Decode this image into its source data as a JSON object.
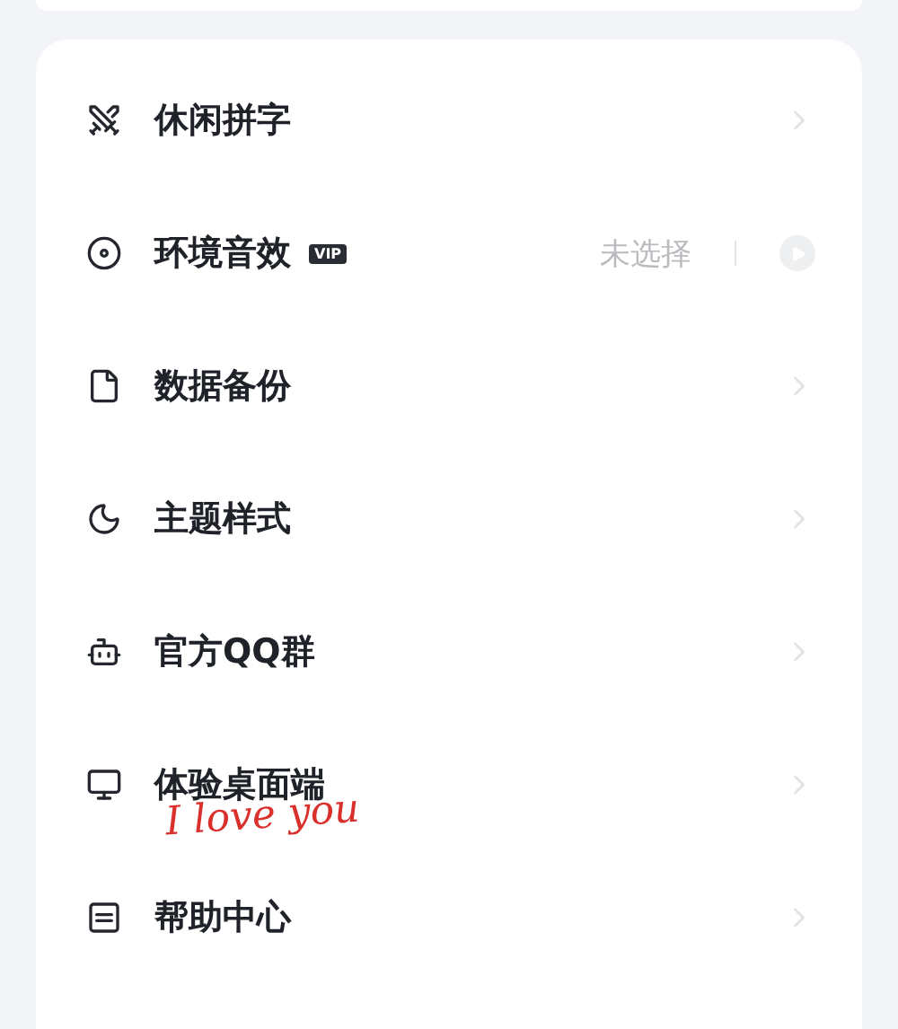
{
  "menu": [
    {
      "kind": "link",
      "label": "休闲拼字"
    },
    {
      "kind": "select",
      "label": "环境音效",
      "badge": "VIP",
      "value": "未选择"
    },
    {
      "kind": "link",
      "label": "数据备份"
    },
    {
      "kind": "link",
      "label": "主题样式"
    },
    {
      "kind": "link",
      "label": "官方QQ群"
    },
    {
      "kind": "link",
      "label": "体验桌面端"
    },
    {
      "kind": "link",
      "label": "帮助中心"
    }
  ],
  "sticker": "I love you"
}
